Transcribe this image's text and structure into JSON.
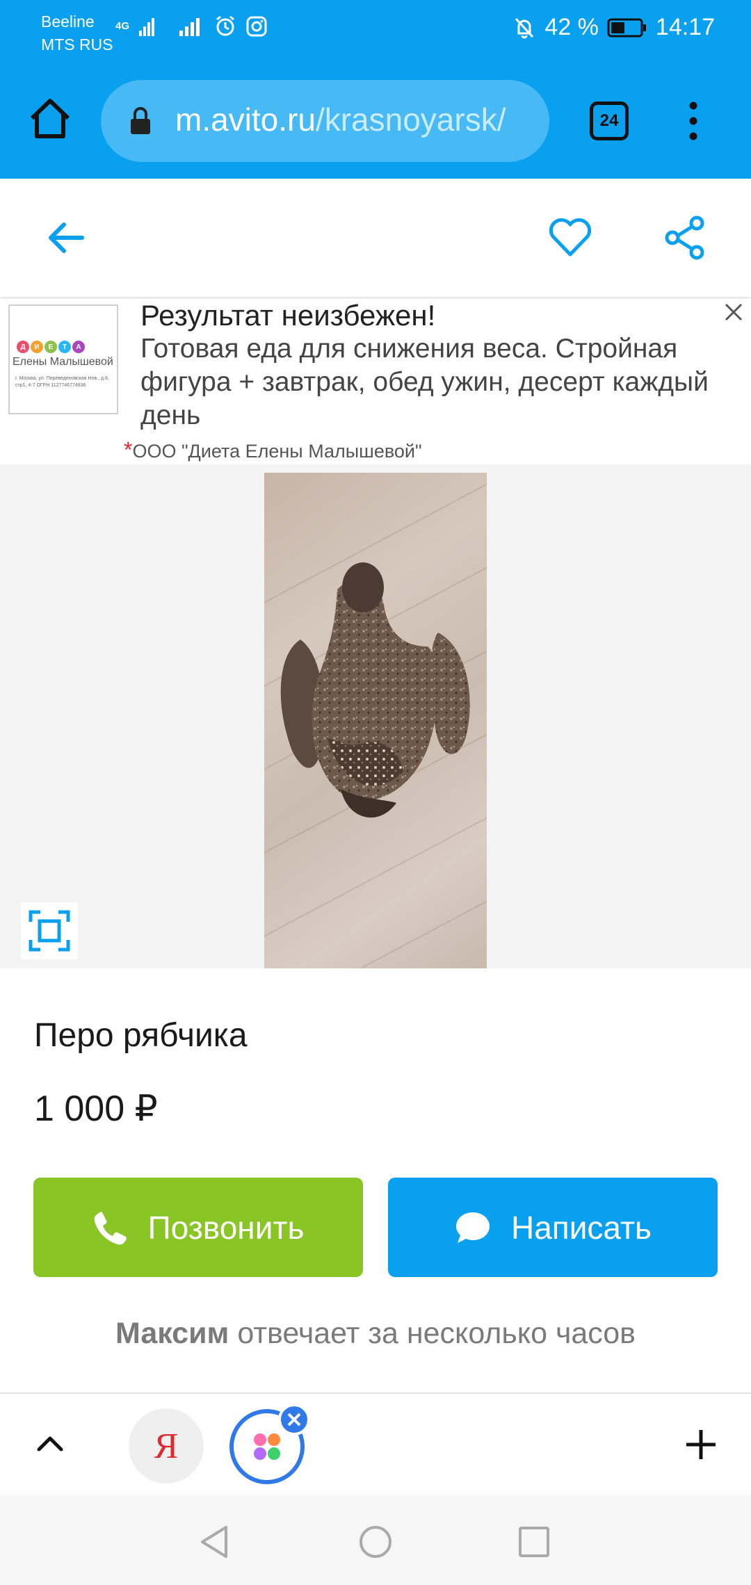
{
  "status_bar": {
    "carrier1": "Beeline",
    "carrier2": "MTS RUS",
    "network": "4G",
    "battery": "42 %",
    "time": "14:17"
  },
  "browser": {
    "url_host": "m.avito.ru",
    "url_path": "/krasnoyarsk/",
    "tab_count": "24"
  },
  "ad": {
    "logo_letters": "ДИЕТА",
    "logo_name": "Елены Малышевой",
    "logo_address": "г. Москва, ул. Переведеновская Нов., д.8, стр1, 4-7 ОГРН 1127746774836",
    "title": "Результат неизбежен!",
    "description": "Готовая еда для снижения веса. Стройная фигура + завтрак, обед ужин, десерт каждый день",
    "advertiser_mark": "*",
    "advertiser": "ООО \"Диета Елены Малышевой\""
  },
  "listing": {
    "title": "Перо рябчика",
    "price": "1 000 ₽",
    "call_label": "Позвонить",
    "write_label": "Написать",
    "seller_name": "Максим",
    "seller_response": "отвечает за несколько часов"
  },
  "toolbar": {
    "yandex_letter": "Я"
  },
  "colors": {
    "brand_blue": "#0aa0f0",
    "call_green": "#8ac526",
    "alice_blue": "#3079e8"
  },
  "icons": [
    "home-icon",
    "lock-icon",
    "tabs-icon",
    "menu-icon",
    "back-arrow-icon",
    "heart-icon",
    "share-icon",
    "close-icon",
    "fullscreen-icon",
    "phone-icon",
    "chat-icon",
    "chevron-up-icon",
    "plus-icon"
  ]
}
